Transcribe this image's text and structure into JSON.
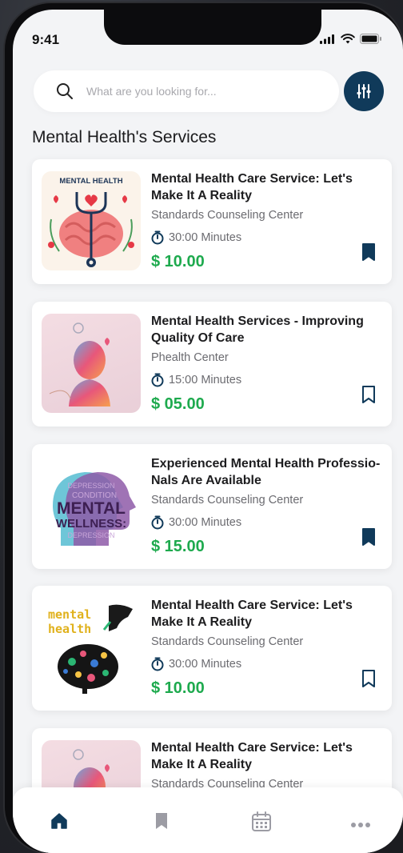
{
  "status": {
    "time": "9:41"
  },
  "search": {
    "placeholder": "What are you looking for..."
  },
  "section_title": "Mental Health's Services",
  "thumb_text": {
    "mental_health_banner": "MENTAL HEALTH",
    "wellness_big": "MENTAL",
    "wellness_sub": "WELLNESS:",
    "wellness_words": [
      "DEPRESSION",
      "CONDITION",
      "DEPRESSION"
    ],
    "handwritten_line1": "mental",
    "handwritten_line2": "health"
  },
  "services": [
    {
      "title": "Mental Health Care Service: Let's Make It A Reality",
      "center": "Standards Counseling Center",
      "duration": "30:00 Minutes",
      "price": "$ 10.00",
      "bookmarked": true
    },
    {
      "title": "Mental Health Services - Improving Quality Of Care",
      "center": "Phealth Center",
      "duration": "15:00 Minutes",
      "price": "$ 05.00",
      "bookmarked": false
    },
    {
      "title": "Experienced Mental Health Professio- Nals Are Available",
      "center": "Standards Counseling Center",
      "duration": "30:00 Minutes",
      "price": "$ 15.00",
      "bookmarked": true
    },
    {
      "title": "Mental Health Care Service: Let's Make It A Reality",
      "center": "Standards Counseling Center",
      "duration": "30:00 Minutes",
      "price": "$ 10.00",
      "bookmarked": false
    },
    {
      "title": "Mental Health Care Service: Let's Make It A Reality",
      "center": "Standards Counseling Center",
      "duration": "",
      "price": "",
      "bookmarked": false
    }
  ],
  "bottom_nav": [
    {
      "icon": "home-icon",
      "active": true
    },
    {
      "icon": "bookmark-icon",
      "active": false
    },
    {
      "icon": "calendar-icon",
      "active": false
    },
    {
      "icon": "more-icon",
      "active": false
    }
  ],
  "colors": {
    "accent": "#103a5a",
    "price": "#1eaa4e",
    "background": "#f3f4f6"
  }
}
